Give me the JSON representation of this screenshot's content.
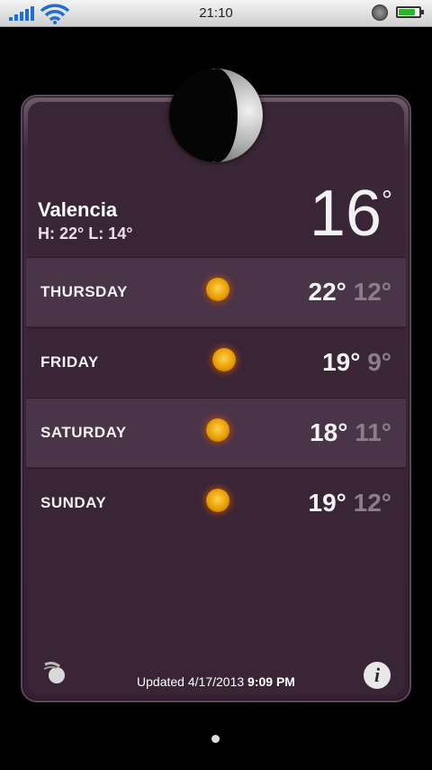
{
  "statusbar": {
    "time": "21:10",
    "icons": [
      "signal-icon",
      "wifi-icon",
      "alarm-icon",
      "battery-icon"
    ],
    "battery_level": 0.8
  },
  "weather": {
    "city": "Valencia",
    "hilo": "H: 22° L: 14°",
    "current_temp": "16",
    "degree": "°",
    "forecast": [
      {
        "day": "THURSDAY",
        "hi": "22°",
        "lo": "12°",
        "icon": "sun-icon"
      },
      {
        "day": "FRIDAY",
        "hi": "19°",
        "lo": "9°",
        "icon": "sun-icon"
      },
      {
        "day": "SATURDAY",
        "hi": "18°",
        "lo": "11°",
        "icon": "sun-icon"
      },
      {
        "day": "SUNDAY",
        "hi": "19°",
        "lo": "12°",
        "icon": "sun-icon"
      }
    ]
  },
  "footer": {
    "updated_label": "Updated",
    "updated_date": "4/17/2013",
    "updated_time": "9:09 PM",
    "info_glyph": "i"
  },
  "colors": {
    "card_bg": "#3a2537",
    "alt_row": "#4a3448",
    "low_temp": "#8a7e89"
  }
}
